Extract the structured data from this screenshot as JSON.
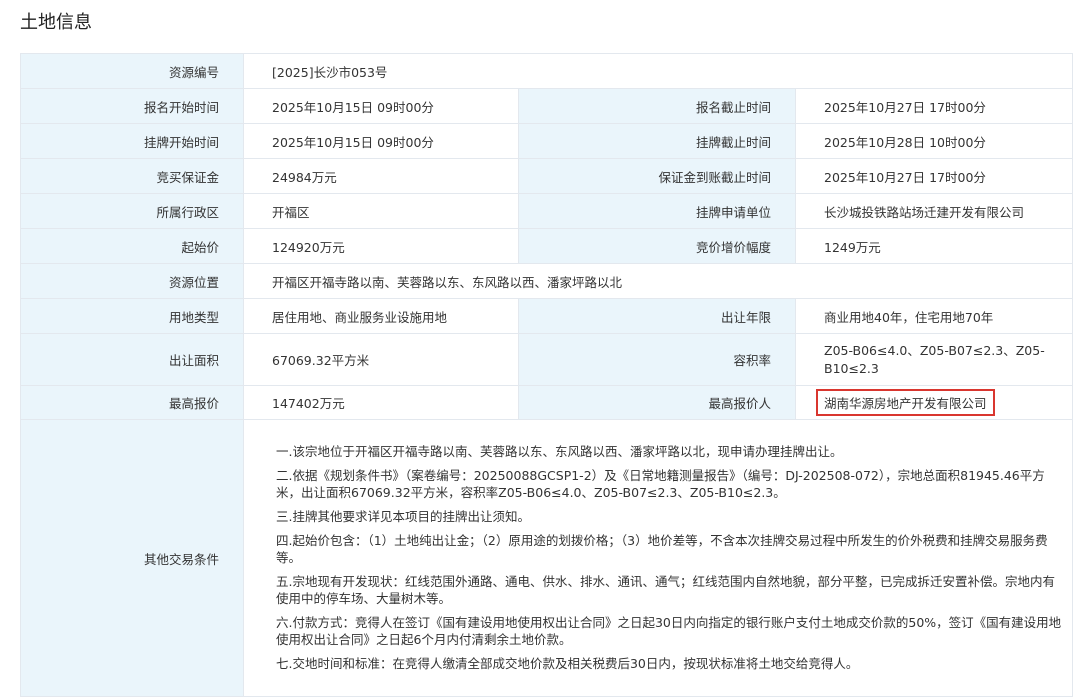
{
  "page": {
    "title": "土地信息"
  },
  "rows": {
    "resource_no": {
      "label": "资源编号",
      "value": "[2025]长沙市053号"
    },
    "signup_start": {
      "label": "报名开始时间",
      "value": "2025年10月15日 09时00分"
    },
    "signup_end": {
      "label": "报名截止时间",
      "value": "2025年10月27日 17时00分"
    },
    "listing_start": {
      "label": "挂牌开始时间",
      "value": "2025年10月15日 09时00分"
    },
    "listing_end": {
      "label": "挂牌截止时间",
      "value": "2025年10月28日 10时00分"
    },
    "deposit": {
      "label": "竞买保证金",
      "value": "24984万元"
    },
    "deposit_deadline": {
      "label": "保证金到账截止时间",
      "value": "2025年10月27日 17时00分"
    },
    "district": {
      "label": "所属行政区",
      "value": "开福区"
    },
    "applicant": {
      "label": "挂牌申请单位",
      "value": "长沙城投铁路站场迁建开发有限公司"
    },
    "start_price": {
      "label": "起始价",
      "value": "124920万元"
    },
    "increment": {
      "label": "竞价增价幅度",
      "value": "1249万元"
    },
    "location": {
      "label": "资源位置",
      "value": "开福区开福寺路以南、芙蓉路以东、东风路以西、潘家坪路以北"
    },
    "land_use": {
      "label": "用地类型",
      "value": "居住用地、商业服务业设施用地"
    },
    "term": {
      "label": "出让年限",
      "value": "商业用地40年，住宅用地70年"
    },
    "area": {
      "label": "出让面积",
      "value": "67069.32平方米"
    },
    "far": {
      "label": "容积率",
      "value": "Z05-B06≤4.0、Z05-B07≤2.3、Z05-B10≤2.3"
    },
    "top_price": {
      "label": "最高报价",
      "value": "147402万元"
    },
    "top_bidder": {
      "label": "最高报价人",
      "value": "湖南华源房地产开发有限公司"
    }
  },
  "conditions": {
    "label": "其他交易条件",
    "items": [
      "一.该宗地位于开福区开福寺路以南、芙蓉路以东、东风路以西、潘家坪路以北，现申请办理挂牌出让。",
      "二.依据《规划条件书》（案卷编号：20250088GCSP1-2）及《日常地籍测量报告》（编号：DJ-202508-072），宗地总面积81945.46平方米，出让面积67069.32平方米，容积率Z05-B06≤4.0、Z05-B07≤2.3、Z05-B10≤2.3。",
      "三.挂牌其他要求详见本项目的挂牌出让须知。",
      "四.起始价包含：（1）土地纯出让金；（2）原用途的划拨价格；（3）地价差等，不含本次挂牌交易过程中所发生的价外税费和挂牌交易服务费等。",
      "五.宗地现有开发现状：红线范围外通路、通电、供水、排水、通讯、通气；红线范围内自然地貌，部分平整，已完成拆迁安置补偿。宗地内有使用中的停车场、大量树木等。",
      "六.付款方式：竞得人在签订《国有建设用地使用权出让合同》之日起30日内向指定的银行账户支付土地成交价款的50%，签订《国有建设用地使用权出让合同》之日起6个月内付清剩余土地价款。",
      "七.交地时间和标准：在竞得人缴清全部成交地价款及相关税费后30日内，按现状标准将土地交给竞得人。"
    ]
  },
  "colors": {
    "label_bg": "#eaf5fb",
    "border": "#e3e8ee",
    "highlight": "#d9362f"
  }
}
